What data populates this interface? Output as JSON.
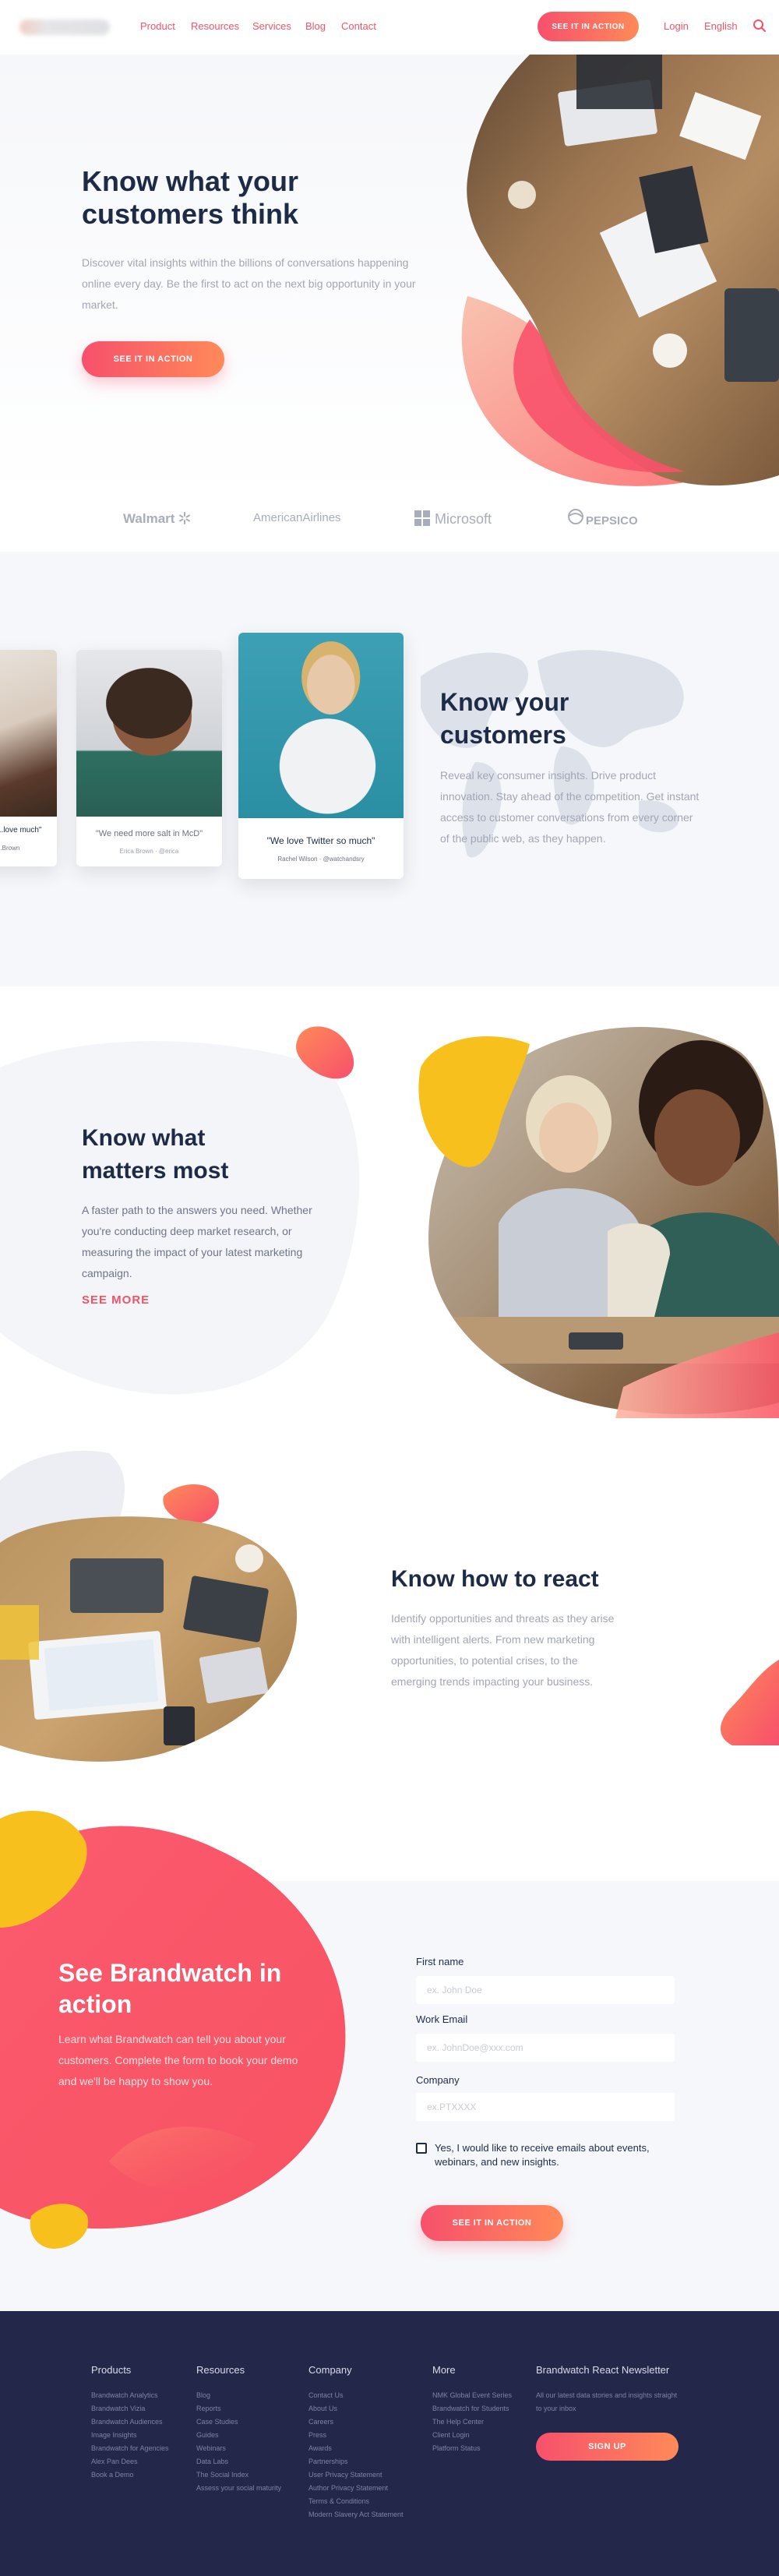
{
  "header": {
    "nav": [
      "Product",
      "Resources",
      "Services",
      "Blog",
      "Contact"
    ],
    "cta": "SEE IT IN ACTION",
    "login": "Login",
    "language": "English",
    "search_icon": "search-icon"
  },
  "hero": {
    "title_line1": "Know what your",
    "title_line2": "customers think",
    "body": "Discover vital insights within the billions of conversations happening online every day. Be the first to act on the next big opportunity in your market.",
    "cta": "SEE IT IN ACTION"
  },
  "logos": {
    "walmart": "Walmart",
    "american": "AmericanAirlines",
    "microsoft": "Microsoft",
    "pepsico": "PEPSICO"
  },
  "customers": {
    "title_line1": "Know your",
    "title_line2": "customers",
    "body": "Reveal key consumer insights. Drive product innovation. Stay ahead of the competition. Get instant access to customer conversations from every corner of the public web, as they happen.",
    "cards": [
      {
        "quote": "...love much\"",
        "who": "...Brown"
      },
      {
        "quote": "\"We need more salt in McD\"",
        "who": "Erica Brown · @erica"
      },
      {
        "quote": "\"We love Twitter so much\"",
        "who": "Rachel Wilson · @watchandsry"
      }
    ]
  },
  "matters": {
    "title_line1": "Know what",
    "title_line2": "matters most",
    "body": "A faster path to the answers you need. Whether you're conducting deep market research, or measuring the impact of your latest marketing campaign.",
    "link": "SEE MORE"
  },
  "react": {
    "title": "Know how to react",
    "body": "Identify opportunities and threats as they arise with intelligent alerts. From new marketing opportunities, to potential crises, to the emerging trends impacting your business."
  },
  "demo": {
    "title_line1": "See Brandwatch in",
    "title_line2": "action",
    "body": "Learn what Brandwatch can tell you about your customers. Complete the form to book your demo and we'll be happy to show you.",
    "form": {
      "first_name_label": "First  name",
      "first_name_placeholder": "ex. John Doe",
      "email_label": "Work Email",
      "email_placeholder": "ex. JohnDoe@xxx.com",
      "company_label": "Company",
      "company_placeholder": "ex.PTXXXX",
      "consent": "Yes, I would like to receive emails about events, webinars, and new insights.",
      "submit": "SEE IT IN ACTION"
    }
  },
  "footer": {
    "columns": [
      {
        "title": "Products",
        "items": [
          "Brandwatch Analytics",
          "Brandwatch Vizia",
          "Brandwatch Audiences",
          "Image Insights",
          "Brandwatch for Agencies",
          "Alex Pan Dees",
          "Book a Demo"
        ]
      },
      {
        "title": "Resources",
        "items": [
          "Blog",
          "Reports",
          "Case Studies",
          "Guides",
          "Webinars",
          "Data Labs",
          "The Social Index",
          "Assess your social maturity"
        ]
      },
      {
        "title": "Company",
        "items": [
          "Contact Us",
          "About Us",
          "Careers",
          "Press",
          "Awards",
          "Partnerships",
          "User Privacy Statement",
          "Author Privacy Statement",
          "Terms & Conditions",
          "Modern Slavery Act Statement"
        ]
      },
      {
        "title": "More",
        "items": [
          "NMK Global Event Series",
          "Brandwatch for Students",
          "The Help Center",
          "Client Login",
          "Platform Status"
        ]
      }
    ],
    "newsletter": {
      "title": "Brandwatch React Newsletter",
      "body": "All our latest data stories and insights straight to your inbox",
      "button": "SIGN UP"
    }
  },
  "colors": {
    "accent": "#f0546a",
    "gradient_start": "#f7506c",
    "gradient_end": "#ff8a58",
    "navy": "#1d2b47",
    "footer_bg": "#23284b",
    "yellow": "#f8c01d"
  }
}
